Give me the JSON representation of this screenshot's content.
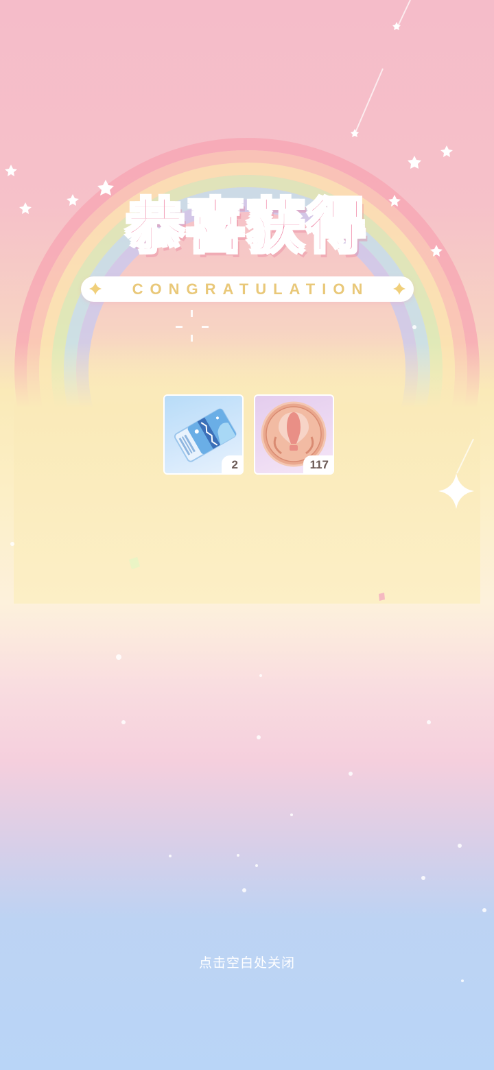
{
  "popup": {
    "title": "恭喜获得",
    "subtitle": "CONGRATULATION",
    "close_hint": "点击空白处关闭"
  },
  "rewards": [
    {
      "name": "ticket",
      "icon": "ticket-icon",
      "quantity": "2"
    },
    {
      "name": "medal",
      "icon": "balloon-medal-icon",
      "quantity": "117"
    }
  ],
  "colors": {
    "title": "#ec6c93",
    "subtitle": "#e9c879",
    "background_top": "#f5bcc9",
    "background_bottom": "#b9d5f7"
  }
}
